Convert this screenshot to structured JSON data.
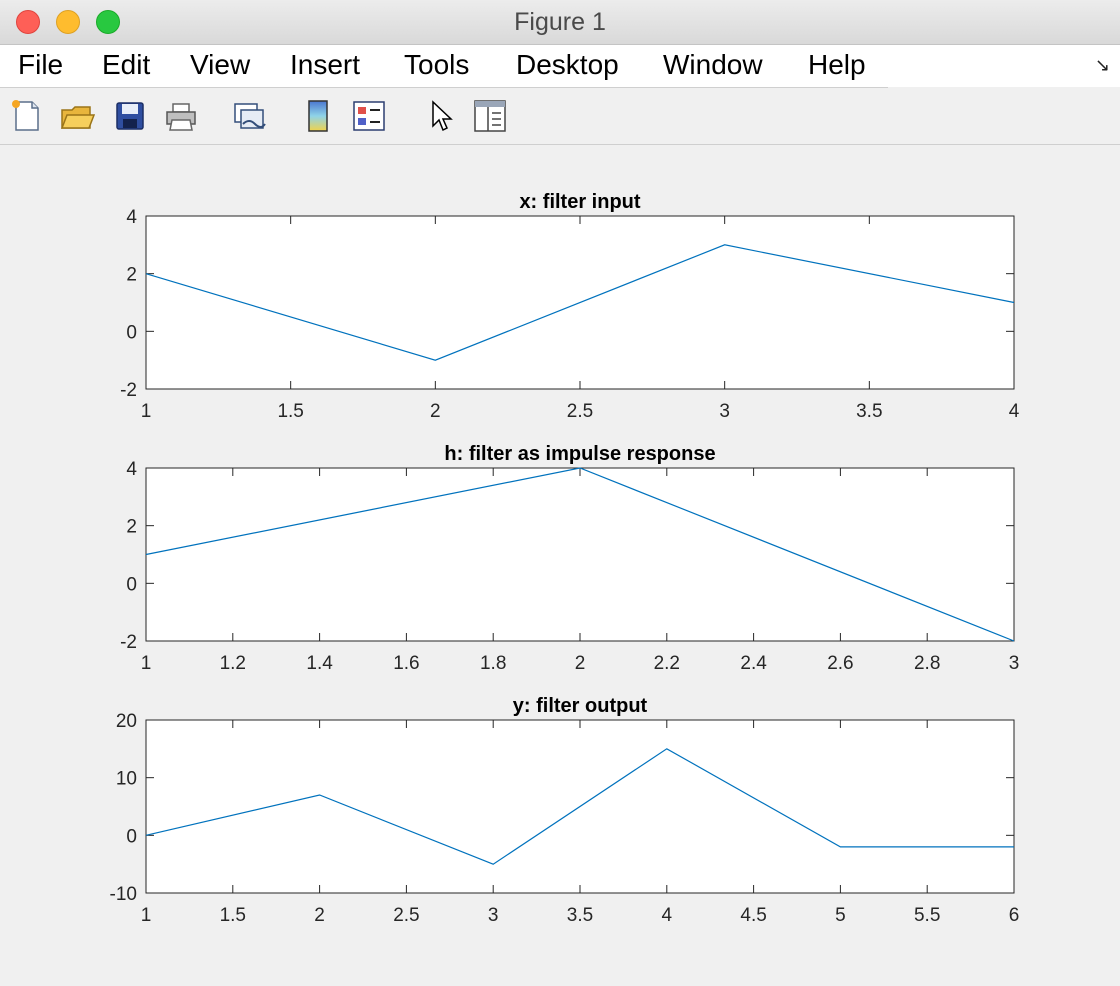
{
  "window": {
    "title": "Figure 1"
  },
  "menu": [
    "File",
    "Edit",
    "View",
    "Insert",
    "Tools",
    "Desktop",
    "Window",
    "Help"
  ],
  "toolbar": [
    "new-figure-icon",
    "open-file-icon",
    "save-icon",
    "print-icon",
    "link-plot-icon",
    "colorbar-icon",
    "legend-icon",
    "pointer-icon",
    "property-inspector-icon"
  ],
  "colors": {
    "series": "#0072bd",
    "figure_bg": "#f0f0f0",
    "axes_bg": "#ffffff"
  },
  "chart_data": [
    {
      "type": "line",
      "title": "x: filter input",
      "x": [
        1,
        2,
        3,
        4
      ],
      "y": [
        2,
        -1,
        3,
        1
      ],
      "xlim": [
        1,
        4
      ],
      "ylim": [
        -2,
        4
      ],
      "xticks": [
        1,
        1.5,
        2,
        2.5,
        3,
        3.5,
        4
      ],
      "yticks": [
        -2,
        0,
        2,
        4
      ],
      "xtick_labels": [
        "1",
        "1.5",
        "2",
        "2.5",
        "3",
        "3.5",
        "4"
      ],
      "ytick_labels": [
        "-2",
        "0",
        "2",
        "4"
      ],
      "grid": false
    },
    {
      "type": "line",
      "title": "h: filter as impulse response",
      "x": [
        1,
        2,
        3
      ],
      "y": [
        1,
        4,
        -2
      ],
      "xlim": [
        1,
        3
      ],
      "ylim": [
        -2,
        4
      ],
      "xticks": [
        1,
        1.2,
        1.4,
        1.6,
        1.8,
        2,
        2.2,
        2.4,
        2.6,
        2.8,
        3
      ],
      "yticks": [
        -2,
        0,
        2,
        4
      ],
      "xtick_labels": [
        "1",
        "1.2",
        "1.4",
        "1.6",
        "1.8",
        "2",
        "2.2",
        "2.4",
        "2.6",
        "2.8",
        "3"
      ],
      "ytick_labels": [
        "-2",
        "0",
        "2",
        "4"
      ],
      "grid": false
    },
    {
      "type": "line",
      "title": "y: filter output",
      "x": [
        1,
        2,
        3,
        4,
        5,
        6
      ],
      "y": [
        0,
        7,
        -5,
        15,
        -2,
        -2
      ],
      "xlim": [
        1,
        6
      ],
      "ylim": [
        -10,
        20
      ],
      "xticks": [
        1,
        1.5,
        2,
        2.5,
        3,
        3.5,
        4,
        4.5,
        5,
        5.5,
        6
      ],
      "yticks": [
        -10,
        0,
        10,
        20
      ],
      "xtick_labels": [
        "1",
        "1.5",
        "2",
        "2.5",
        "3",
        "3.5",
        "4",
        "4.5",
        "5",
        "5.5",
        "6"
      ],
      "ytick_labels": [
        "-10",
        "0",
        "10",
        "20"
      ],
      "grid": false
    }
  ]
}
